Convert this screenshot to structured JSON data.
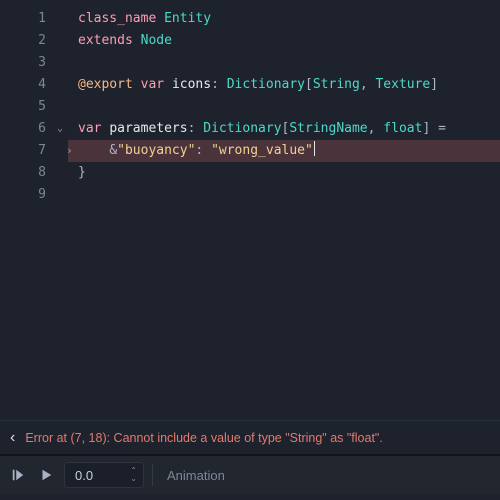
{
  "code": {
    "lines": [
      {
        "n": 1,
        "fold": null,
        "error": false,
        "tokens": [
          [
            "kw",
            "class_name"
          ],
          [
            "sp",
            " "
          ],
          [
            "type",
            "Entity"
          ]
        ]
      },
      {
        "n": 2,
        "fold": null,
        "error": false,
        "tokens": [
          [
            "kw",
            "extends"
          ],
          [
            "sp",
            " "
          ],
          [
            "type",
            "Node"
          ]
        ]
      },
      {
        "n": 3,
        "fold": null,
        "error": false,
        "tokens": []
      },
      {
        "n": 4,
        "fold": null,
        "error": false,
        "tokens": [
          [
            "attr",
            "@export"
          ],
          [
            "sp",
            " "
          ],
          [
            "kw",
            "var"
          ],
          [
            "sp",
            " "
          ],
          [
            "ident",
            "icons"
          ],
          [
            "punc",
            ":"
          ],
          [
            "sp",
            " "
          ],
          [
            "type",
            "Dictionary"
          ],
          [
            "punc",
            "["
          ],
          [
            "type",
            "String"
          ],
          [
            "punc",
            ","
          ],
          [
            "sp",
            " "
          ],
          [
            "type",
            "Texture"
          ],
          [
            "punc",
            "]"
          ]
        ]
      },
      {
        "n": 5,
        "fold": null,
        "error": false,
        "tokens": []
      },
      {
        "n": 6,
        "fold": "down",
        "error": false,
        "tokens": [
          [
            "kw",
            "var"
          ],
          [
            "sp",
            " "
          ],
          [
            "ident",
            "parameters"
          ],
          [
            "punc",
            ":"
          ],
          [
            "sp",
            " "
          ],
          [
            "type",
            "Dictionary"
          ],
          [
            "punc",
            "["
          ],
          [
            "type",
            "StringName"
          ],
          [
            "punc",
            ","
          ],
          [
            "sp",
            " "
          ],
          [
            "type",
            "float"
          ],
          [
            "punc",
            "]"
          ],
          [
            "sp",
            " "
          ],
          [
            "punc",
            "="
          ],
          [
            "sp",
            " "
          ]
        ]
      },
      {
        "n": 7,
        "fold": null,
        "error": true,
        "tokens": [
          [
            "sp",
            "    "
          ],
          [
            "punc",
            "&"
          ],
          [
            "str",
            "\"buoyancy\""
          ],
          [
            "punc",
            ":"
          ],
          [
            "sp",
            " "
          ],
          [
            "str",
            "\"wrong_value\""
          ],
          [
            "caret",
            ""
          ]
        ]
      },
      {
        "n": 8,
        "fold": null,
        "error": false,
        "tokens": [
          [
            "punc",
            "}"
          ]
        ]
      },
      {
        "n": 9,
        "fold": null,
        "error": false,
        "tokens": []
      }
    ]
  },
  "error": {
    "text": "Error at (7, 18): Cannot include a value of type \"String\" as \"float\"."
  },
  "anim": {
    "time": "0.0",
    "placeholder": "Animation"
  },
  "icons": {
    "chevron_left": "‹",
    "fold_down": "⌄",
    "spin_up": "⌃",
    "spin_down": "⌄"
  }
}
